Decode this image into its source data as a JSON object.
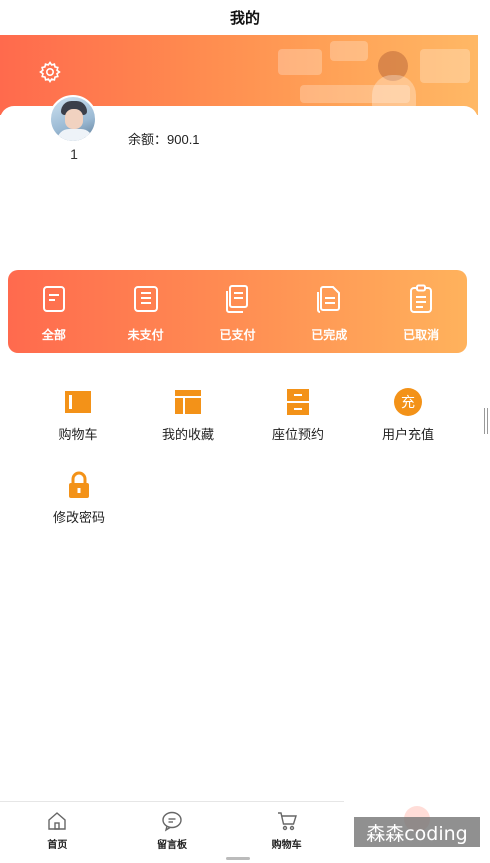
{
  "header": {
    "title": "我的"
  },
  "profile": {
    "username": "1",
    "balance": "余额：900.1"
  },
  "orders": {
    "items": [
      {
        "label": "全部",
        "icon": "order-all-icon"
      },
      {
        "label": "未支付",
        "icon": "order-unpaid-icon"
      },
      {
        "label": "已支付",
        "icon": "order-paid-icon"
      },
      {
        "label": "已完成",
        "icon": "order-completed-icon"
      },
      {
        "label": "已取消",
        "icon": "order-cancelled-icon"
      }
    ]
  },
  "menu": {
    "items": [
      {
        "label": "购物车",
        "icon": "cart-panel-icon"
      },
      {
        "label": "我的收藏",
        "icon": "favorites-icon"
      },
      {
        "label": "座位预约",
        "icon": "seat-reservation-icon"
      },
      {
        "label": "用户充值",
        "icon": "recharge-icon",
        "icon_text": "充"
      },
      {
        "label": "修改密码",
        "icon": "lock-icon"
      }
    ]
  },
  "tabbar": {
    "items": [
      {
        "label": "首页",
        "icon": "home-icon"
      },
      {
        "label": "留言板",
        "icon": "message-icon"
      },
      {
        "label": "购物车",
        "icon": "cart-icon"
      }
    ]
  },
  "watermark": "森森coding",
  "colors": {
    "accent_start": "#ff6a4e",
    "accent_end": "#ffb25c",
    "menu_icon": "#f39218"
  }
}
